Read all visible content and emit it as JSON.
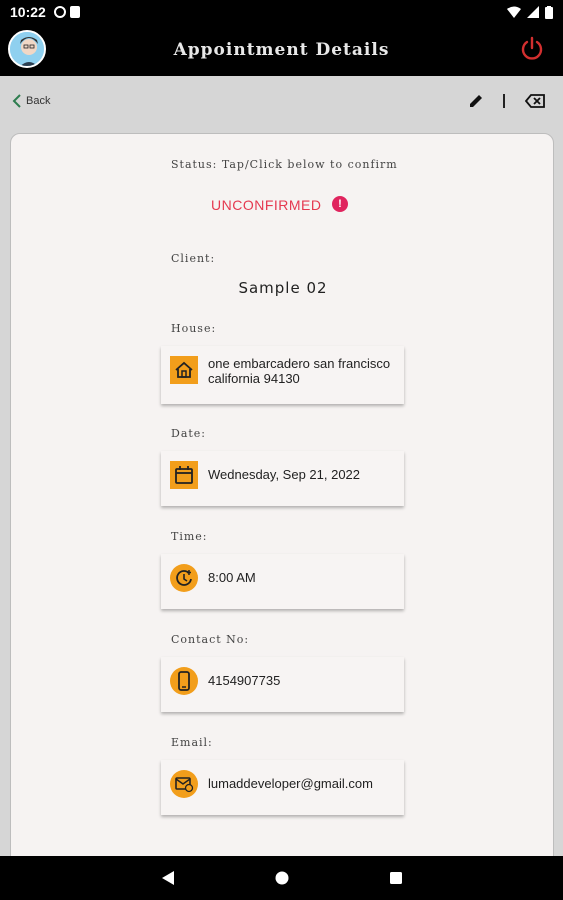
{
  "status_bar": {
    "time": "10:22"
  },
  "app_bar": {
    "title": "Appointment Details"
  },
  "toolbar": {
    "back_label": "Back"
  },
  "details": {
    "status_label": "Status:   Tap/Click below to confirm",
    "status_value": "UNCONFIRMED",
    "status_alert": "!",
    "client_label": "Client:",
    "client_name": "Sample 02",
    "house_label": "House:",
    "house_value": "one embarcadero san francisco california 94130",
    "date_label": "Date:",
    "date_value": "Wednesday,  Sep 21,  2022",
    "time_label": "Time:",
    "time_value": "8:00 AM",
    "contact_label": "Contact No:",
    "contact_value": "4154907735",
    "email_label": "Email:",
    "email_value": "lumaddeveloper@gmail.com"
  },
  "colors": {
    "accent_orange": "#f29e1b",
    "unconfirmed_red": "#e53950",
    "power_red": "#d32f2f",
    "app_bar": "#000000"
  },
  "icons": [
    "power-icon",
    "back-chevron-icon",
    "pencil-icon",
    "backspace-icon",
    "home-icon",
    "calendar-icon",
    "clock-icon",
    "phone-icon",
    "email-icon"
  ]
}
